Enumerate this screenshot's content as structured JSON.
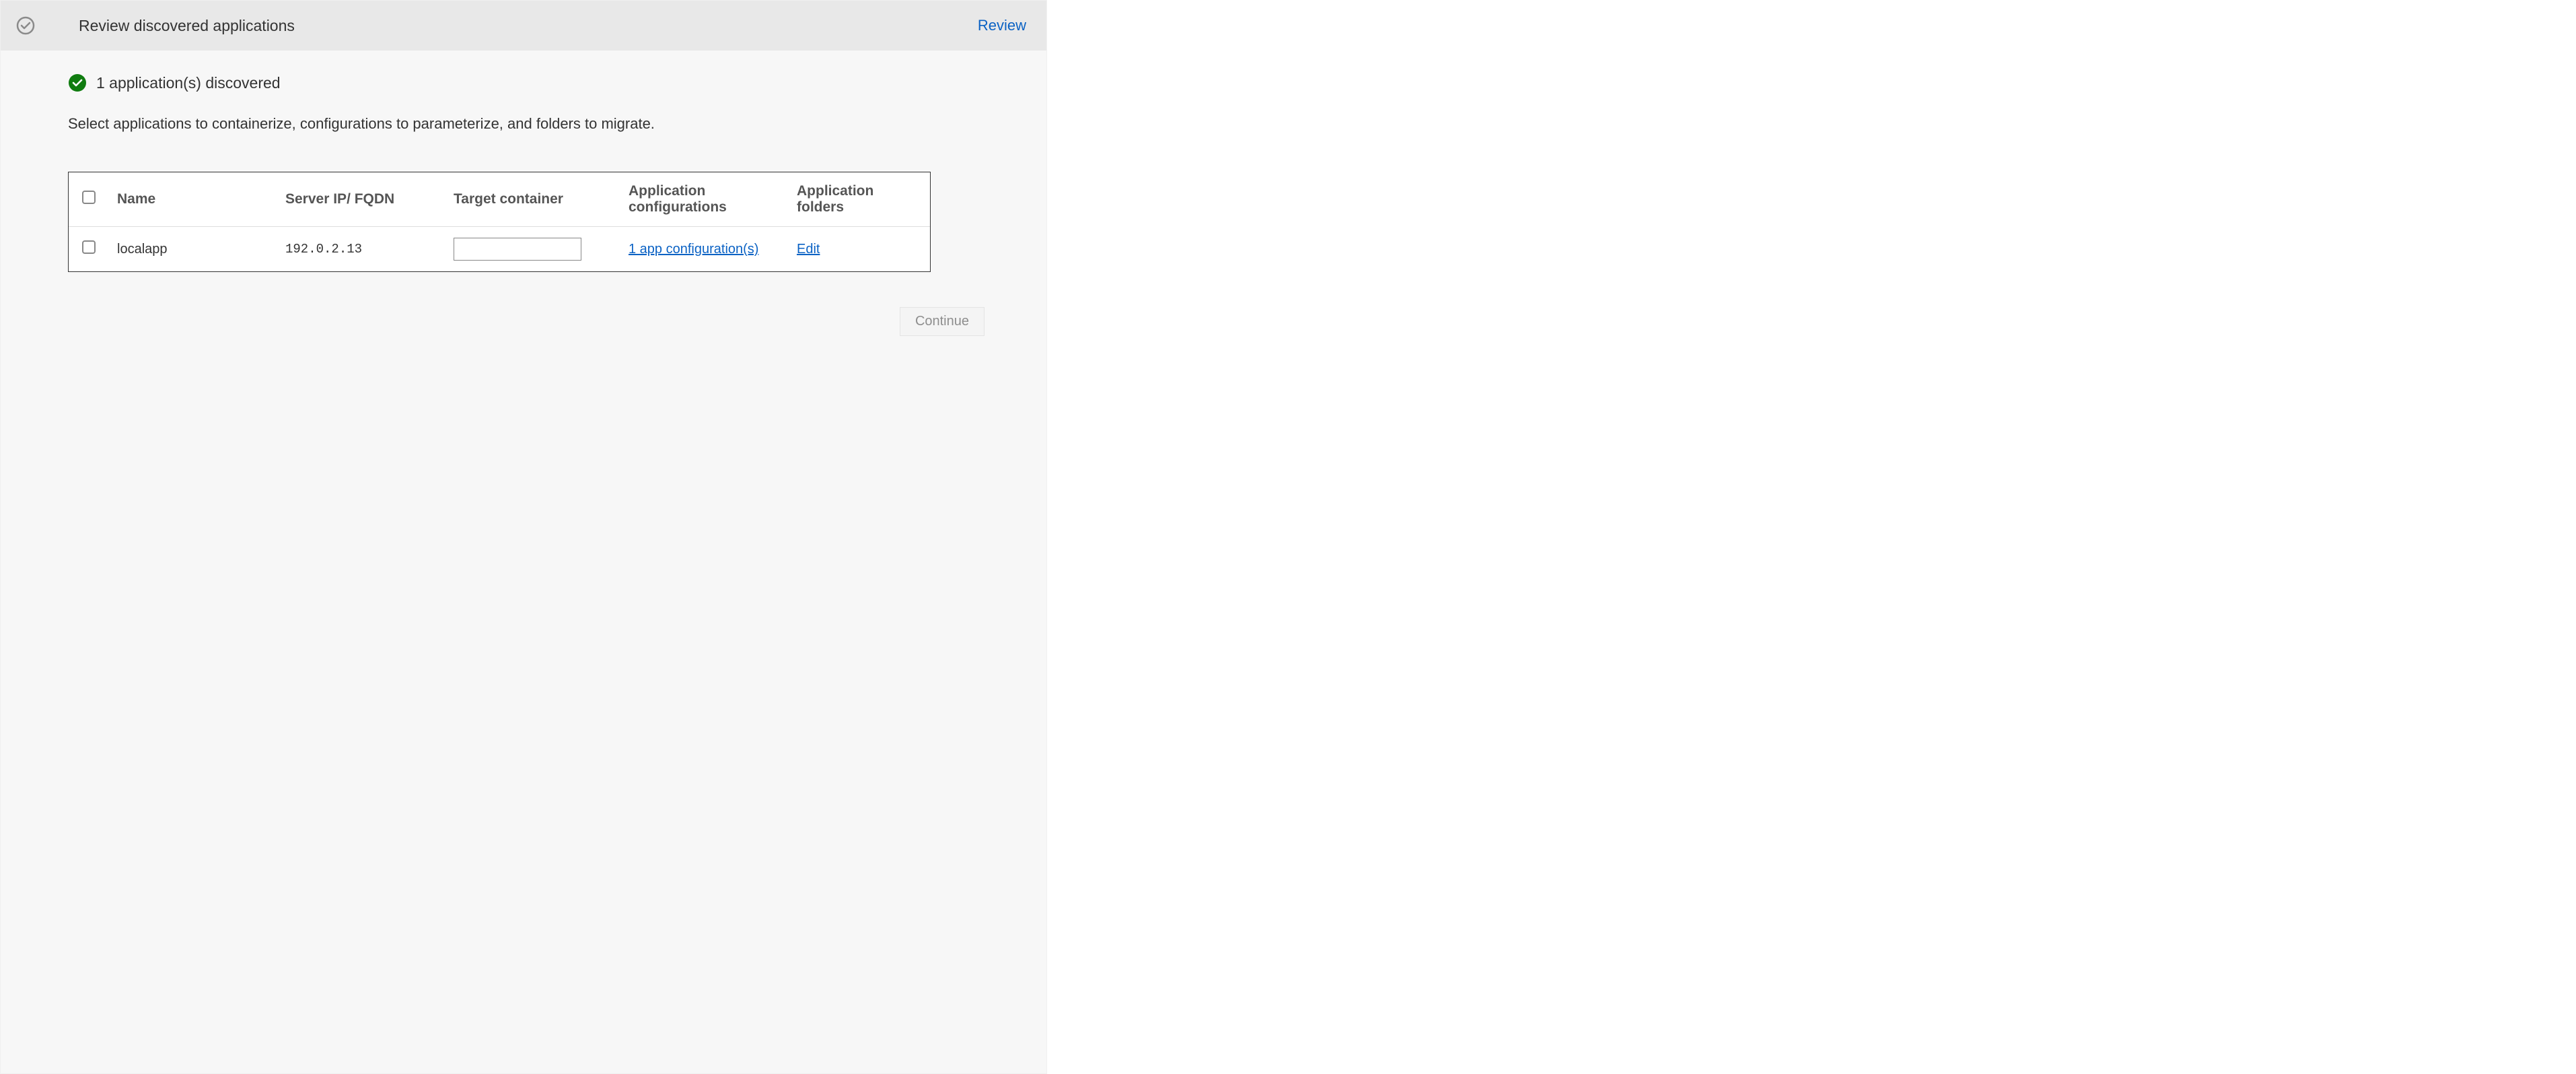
{
  "header": {
    "title": "Review discovered applications",
    "action": "Review"
  },
  "status": {
    "message": "1 application(s) discovered"
  },
  "instruction": "Select applications to containerize, configurations to parameterize, and folders to migrate.",
  "table": {
    "columns": {
      "name": "Name",
      "server": "Server IP/ FQDN",
      "target": "Target container",
      "config": "Application configurations",
      "folders": "Application folders"
    },
    "rows": [
      {
        "name": "localapp",
        "server": "192.0.2.13",
        "target": "",
        "config_link": "1 app configuration(s)",
        "folders_link": "Edit"
      }
    ]
  },
  "footer": {
    "continue": "Continue"
  }
}
